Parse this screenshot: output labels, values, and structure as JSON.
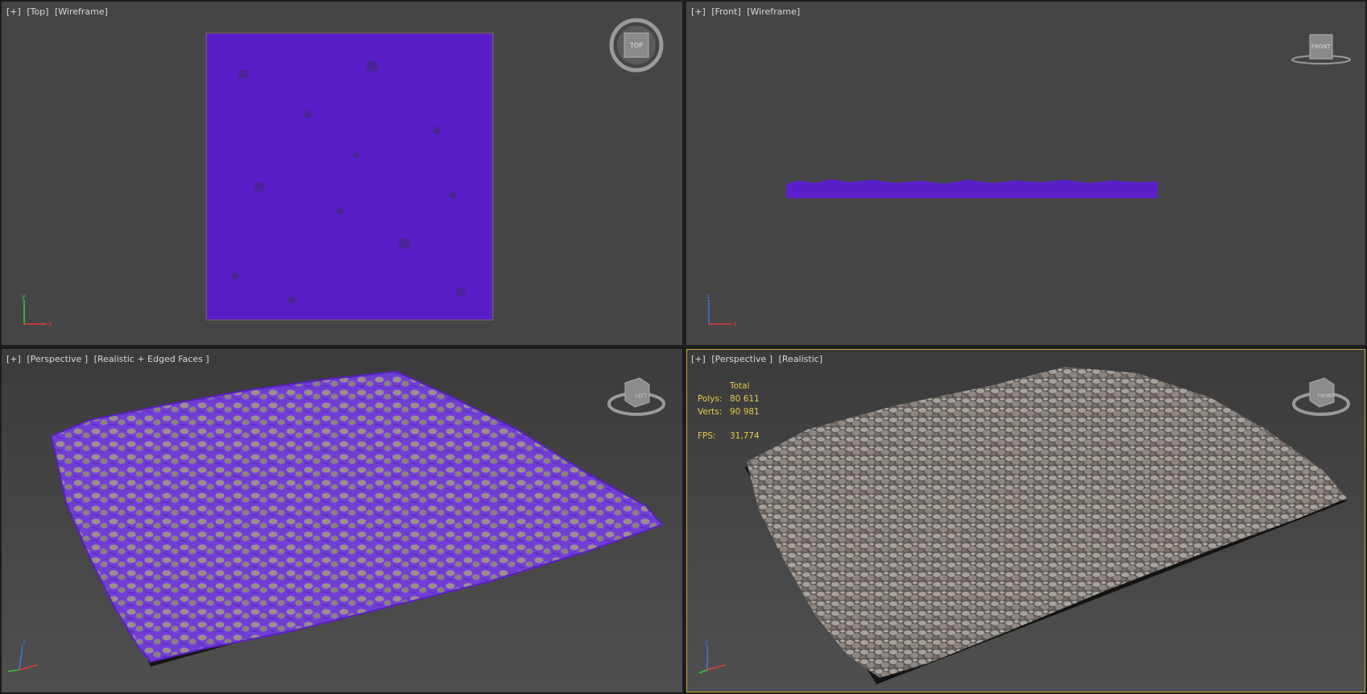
{
  "viewports": {
    "top_left": {
      "menu": "[+]",
      "view": "[Top]",
      "shading": "[Wireframe]",
      "navigator": "TOP"
    },
    "top_right": {
      "menu": "[+]",
      "view": "[Front]",
      "shading": "[Wireframe]",
      "navigator": "FRONT"
    },
    "bottom_left": {
      "menu": "[+]",
      "view": "[Perspective ]",
      "shading": "[Realistic + Edged Faces ]",
      "navigator": "LEFT"
    },
    "bottom_right": {
      "menu": "[+]",
      "view": "[Perspective ]",
      "shading": "[Realistic]",
      "navigator": "FRONT"
    }
  },
  "stats": {
    "header": "Total",
    "polys_label": "Polys:",
    "polys": "80 611",
    "verts_label": "Verts:",
    "verts": "90 981",
    "fps_label": "FPS:",
    "fps": "31,774"
  },
  "axis_labels": {
    "x": "x",
    "y": "y",
    "z": "z"
  },
  "colors": {
    "viewport_bg": "#454545",
    "wire_purple": "#5a1ec8",
    "stats_yellow": "#e6c94a",
    "active_border": "#c8a83c",
    "gravel_gray": "#8c8884"
  }
}
